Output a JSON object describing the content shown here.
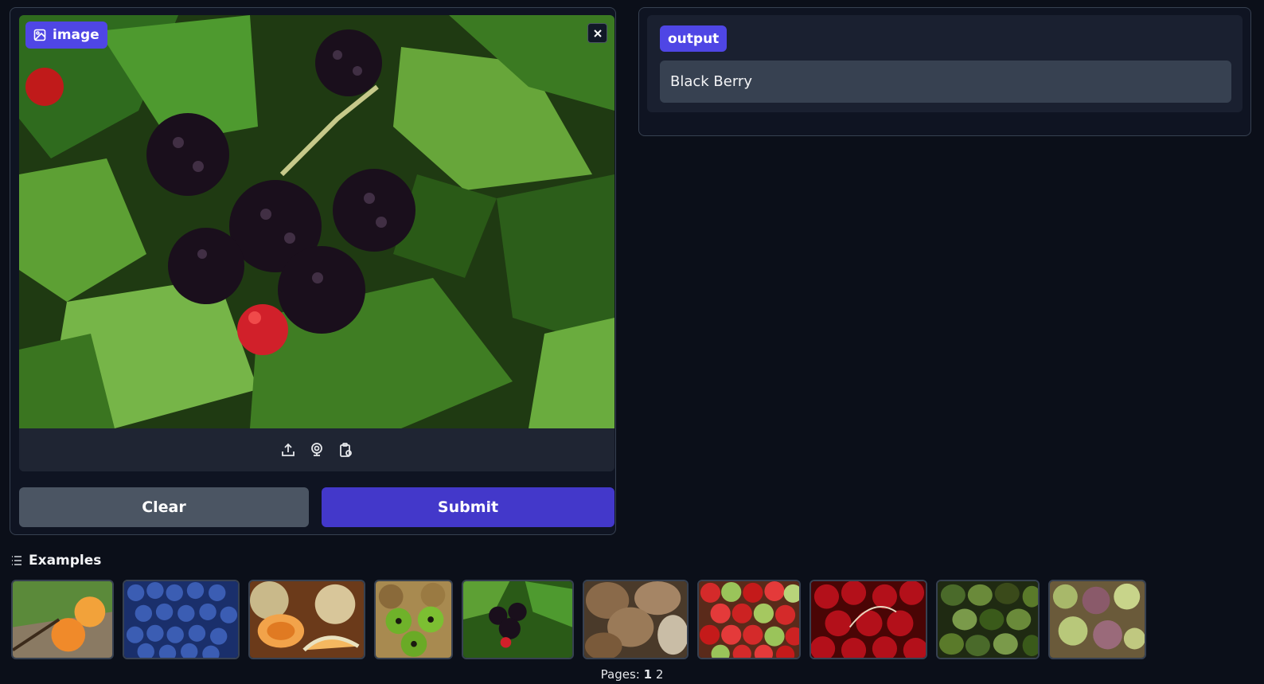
{
  "image_input": {
    "label": "image",
    "subject": "blackberries on a bramble with green serrated leaves"
  },
  "buttons": {
    "clear_label": "Clear",
    "submit_label": "Submit"
  },
  "output": {
    "label": "output",
    "value": "Black Berry"
  },
  "examples": {
    "header": "Examples",
    "thumbnails": [
      "apricot",
      "blueberry",
      "cantaloupe",
      "kiwi",
      "blackberry",
      "coconut",
      "apple",
      "cherry",
      "avocado",
      "fig"
    ]
  },
  "pagination": {
    "prefix": "Pages:",
    "pages": [
      "1",
      "2"
    ],
    "current": "1"
  },
  "icons": {
    "image_label": "image-icon",
    "close": "close-icon",
    "upload": "upload-icon",
    "webcam": "webcam-icon",
    "paste": "clipboard-icon",
    "examples": "list-icon"
  }
}
